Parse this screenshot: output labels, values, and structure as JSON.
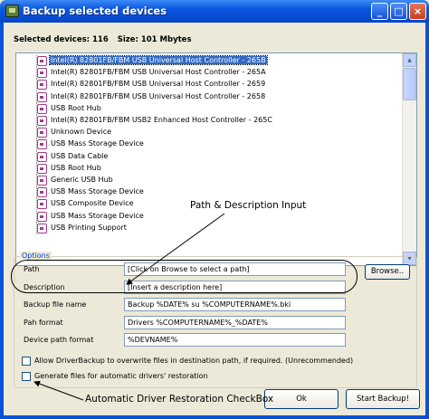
{
  "window": {
    "title": "Backup selected devices",
    "icon": "app-icon"
  },
  "titlebar_buttons": {
    "minimize": "_",
    "maximize": "□",
    "close": "×"
  },
  "summary": {
    "devices_label": "Selected devices:",
    "devices_count": "116",
    "size_label": "Size:",
    "size_value": "101 Mbytes"
  },
  "devices": [
    {
      "label": "Intel(R) 82801FB/FBM USB Universal Host Controller - 265B",
      "selected": true
    },
    {
      "label": "Intel(R) 82801FB/FBM USB Universal Host Controller - 265A",
      "selected": false
    },
    {
      "label": "Intel(R) 82801FB/FBM USB Universal Host Controller - 2659",
      "selected": false
    },
    {
      "label": "Intel(R) 82801FB/FBM USB Universal Host Controller - 2658",
      "selected": false
    },
    {
      "label": "USB Root Hub",
      "selected": false
    },
    {
      "label": "Intel(R) 82801FB/FBM USB2 Enhanced Host Controller - 265C",
      "selected": false
    },
    {
      "label": "Unknown Device",
      "selected": false
    },
    {
      "label": "USB Mass Storage Device",
      "selected": false
    },
    {
      "label": "USB Data Cable",
      "selected": false
    },
    {
      "label": "USB Root Hub",
      "selected": false
    },
    {
      "label": "Generic USB Hub",
      "selected": false
    },
    {
      "label": "USB Mass Storage Device",
      "selected": false
    },
    {
      "label": "USB Composite Device",
      "selected": false
    },
    {
      "label": "USB Mass Storage Device",
      "selected": false
    },
    {
      "label": "USB Printing Support",
      "selected": false
    }
  ],
  "annotations": {
    "path_description": "Path & Description Input",
    "restoration_checkbox": "Automatic Driver Restoration CheckBox"
  },
  "options": {
    "legend": "Options",
    "path_label": "Path",
    "path_value": "[Click on Browse to select a path]",
    "browse_button": "Browse..",
    "description_label": "Description",
    "description_value": "[Insert a description here]",
    "backup_file_label": "Backup file name",
    "backup_file_value": "Backup %DATE% su %COMPUTERNAME%.bki",
    "path_format_label": "Pah format",
    "path_format_value": "Drivers %COMPUTERNAME%_%DATE%",
    "device_path_label": "Device path format",
    "device_path_value": "%DEVNAME%",
    "overwrite_label": "Allow DriverBackup to overwrite files in destination path, if required. (Unrecommended)",
    "overwrite_checked": false,
    "restoration_label": "Generate files for automatic drivers' restoration",
    "restoration_checked": false
  },
  "footer": {
    "ok_button": "Ok",
    "start_button": "Start Backup!"
  },
  "colors": {
    "titlebar": "#0a56e0",
    "selection": "#316ac5",
    "device_icon": "#a03b89",
    "legend_text": "#0046d5"
  }
}
